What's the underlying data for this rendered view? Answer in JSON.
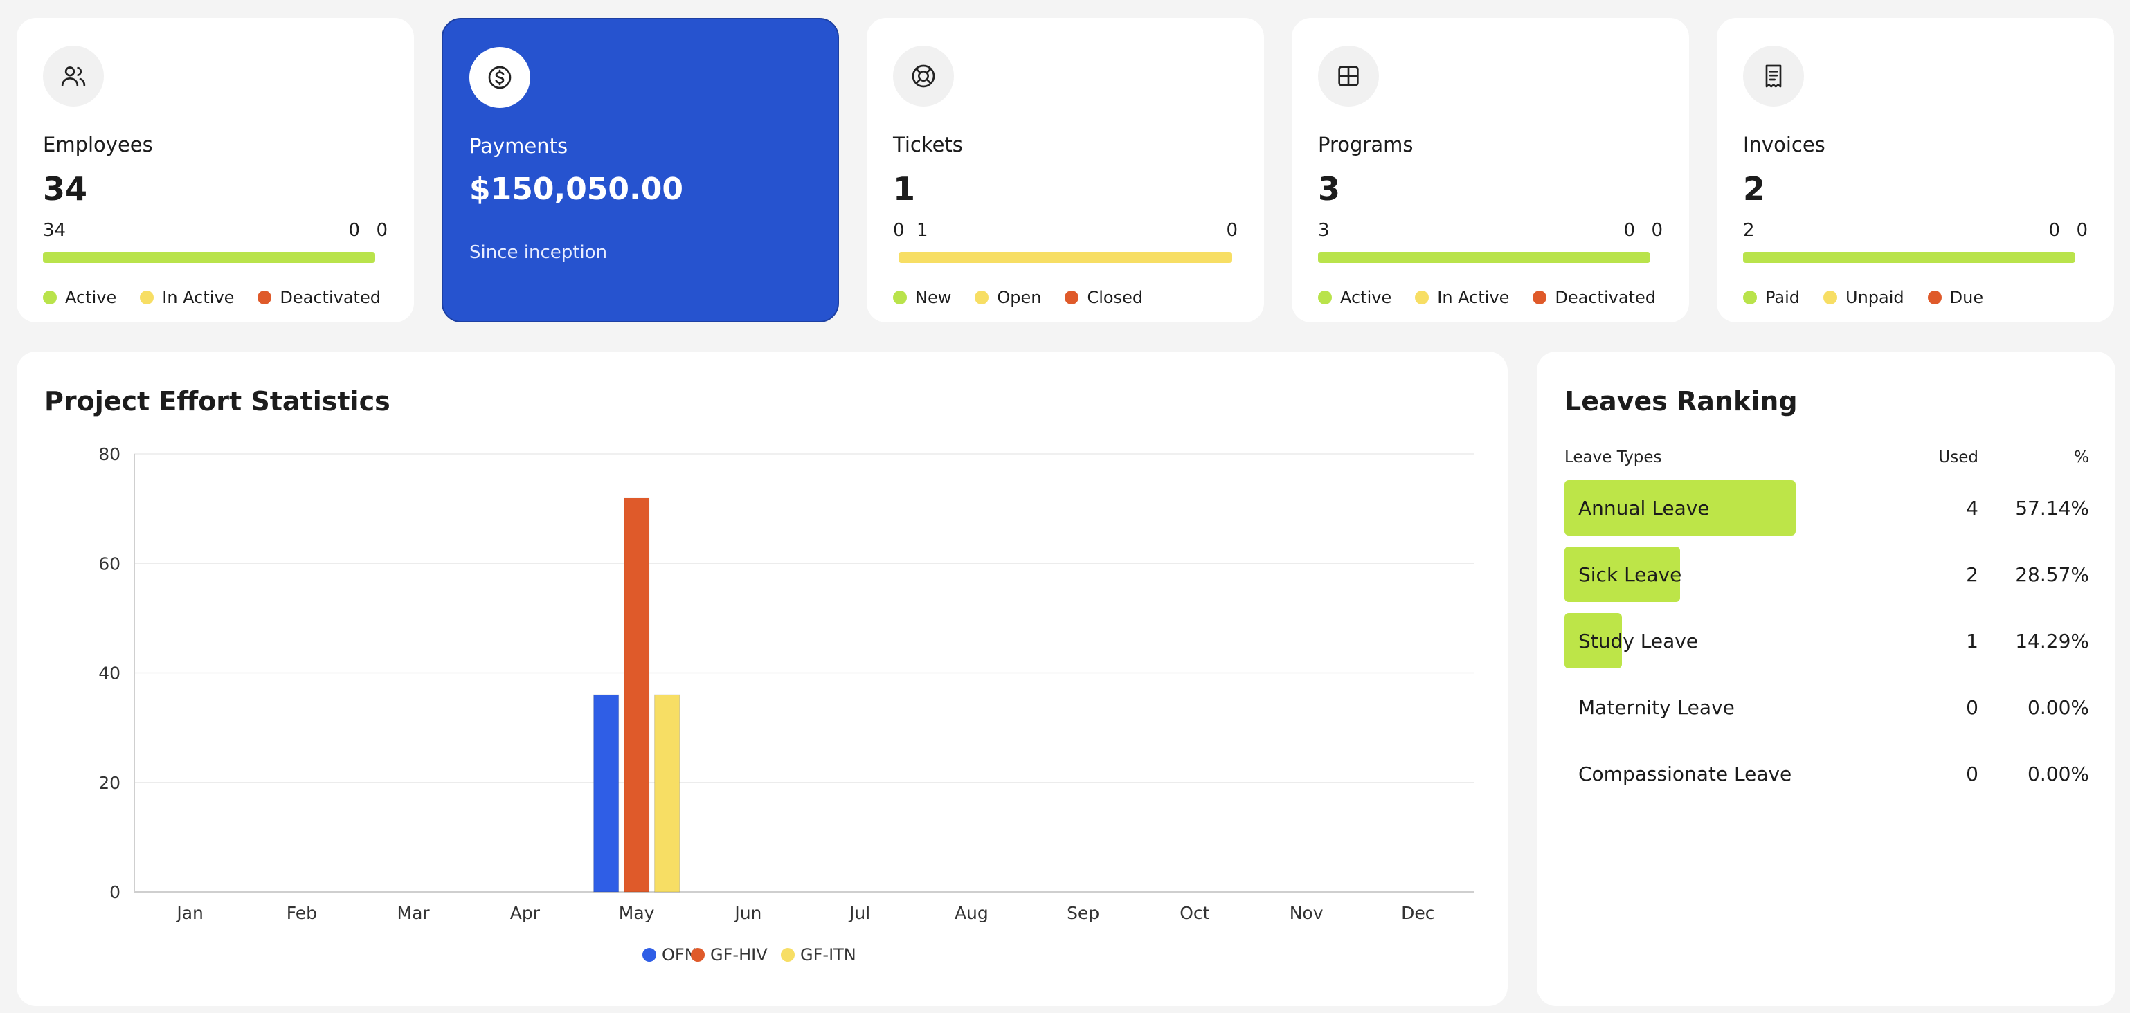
{
  "colors": {
    "accent_blue": "#2653cf",
    "green": "#b9e34b",
    "yellow": "#f7de64",
    "orange": "#df5a2a",
    "chart_blue": "#2f5ee6"
  },
  "cards": {
    "employees": {
      "icon": "users-icon",
      "title": "Employees",
      "value": "34",
      "seg": [
        "34",
        "0",
        "0"
      ],
      "legend": [
        "Active",
        "In Active",
        "Deactivated"
      ]
    },
    "payments": {
      "icon": "dollar-circle-icon",
      "title": "Payments",
      "value": "$150,050.00",
      "sub": "Since inception"
    },
    "tickets": {
      "icon": "lifebuoy-icon",
      "title": "Tickets",
      "value": "1",
      "seg": [
        "0",
        "1",
        "0"
      ],
      "legend": [
        "New",
        "Open",
        "Closed"
      ]
    },
    "programs": {
      "icon": "grid-icon",
      "title": "Programs",
      "value": "3",
      "seg": [
        "3",
        "0",
        "0"
      ],
      "legend": [
        "Active",
        "In Active",
        "Deactivated"
      ]
    },
    "invoices": {
      "icon": "receipt-icon",
      "title": "Invoices",
      "value": "2",
      "seg": [
        "2",
        "0",
        "0"
      ],
      "legend": [
        "Paid",
        "Unpaid",
        "Due"
      ]
    }
  },
  "effort": {
    "title": "Project Effort Statistics"
  },
  "chart_data": {
    "type": "bar",
    "title": "Project Effort Statistics",
    "categories": [
      "Jan",
      "Feb",
      "Mar",
      "Apr",
      "May",
      "Jun",
      "Jul",
      "Aug",
      "Sep",
      "Oct",
      "Nov",
      "Dec"
    ],
    "series": [
      {
        "name": "OFN",
        "color": "#2f5ee6",
        "values": [
          0,
          0,
          0,
          0,
          36,
          0,
          0,
          0,
          0,
          0,
          0,
          0
        ]
      },
      {
        "name": "GF-HIV",
        "color": "#df5a2a",
        "values": [
          0,
          0,
          0,
          0,
          72,
          0,
          0,
          0,
          0,
          0,
          0,
          0
        ]
      },
      {
        "name": "GF-ITN",
        "color": "#f7de64",
        "values": [
          0,
          0,
          0,
          0,
          36,
          0,
          0,
          0,
          0,
          0,
          0,
          0
        ]
      }
    ],
    "yticks": [
      "0",
      "20",
      "40",
      "60",
      "80"
    ],
    "ylim": [
      0,
      80
    ],
    "grid": true,
    "legend": "bottom-center"
  },
  "leaves": {
    "title": "Leaves Ranking",
    "headers": {
      "type": "Leave Types",
      "used": "Used",
      "pct": "%"
    },
    "rows": [
      {
        "name": "Annual Leave",
        "used": "4",
        "pct": "57.14%",
        "share": 0.5714
      },
      {
        "name": "Sick Leave",
        "used": "2",
        "pct": "28.57%",
        "share": 0.2857
      },
      {
        "name": "Study Leave",
        "used": "1",
        "pct": "14.29%",
        "share": 0.1429
      },
      {
        "name": "Maternity Leave",
        "used": "0",
        "pct": "0.00%",
        "share": 0
      },
      {
        "name": "Compassionate Leave",
        "used": "0",
        "pct": "0.00%",
        "share": 0
      }
    ]
  }
}
